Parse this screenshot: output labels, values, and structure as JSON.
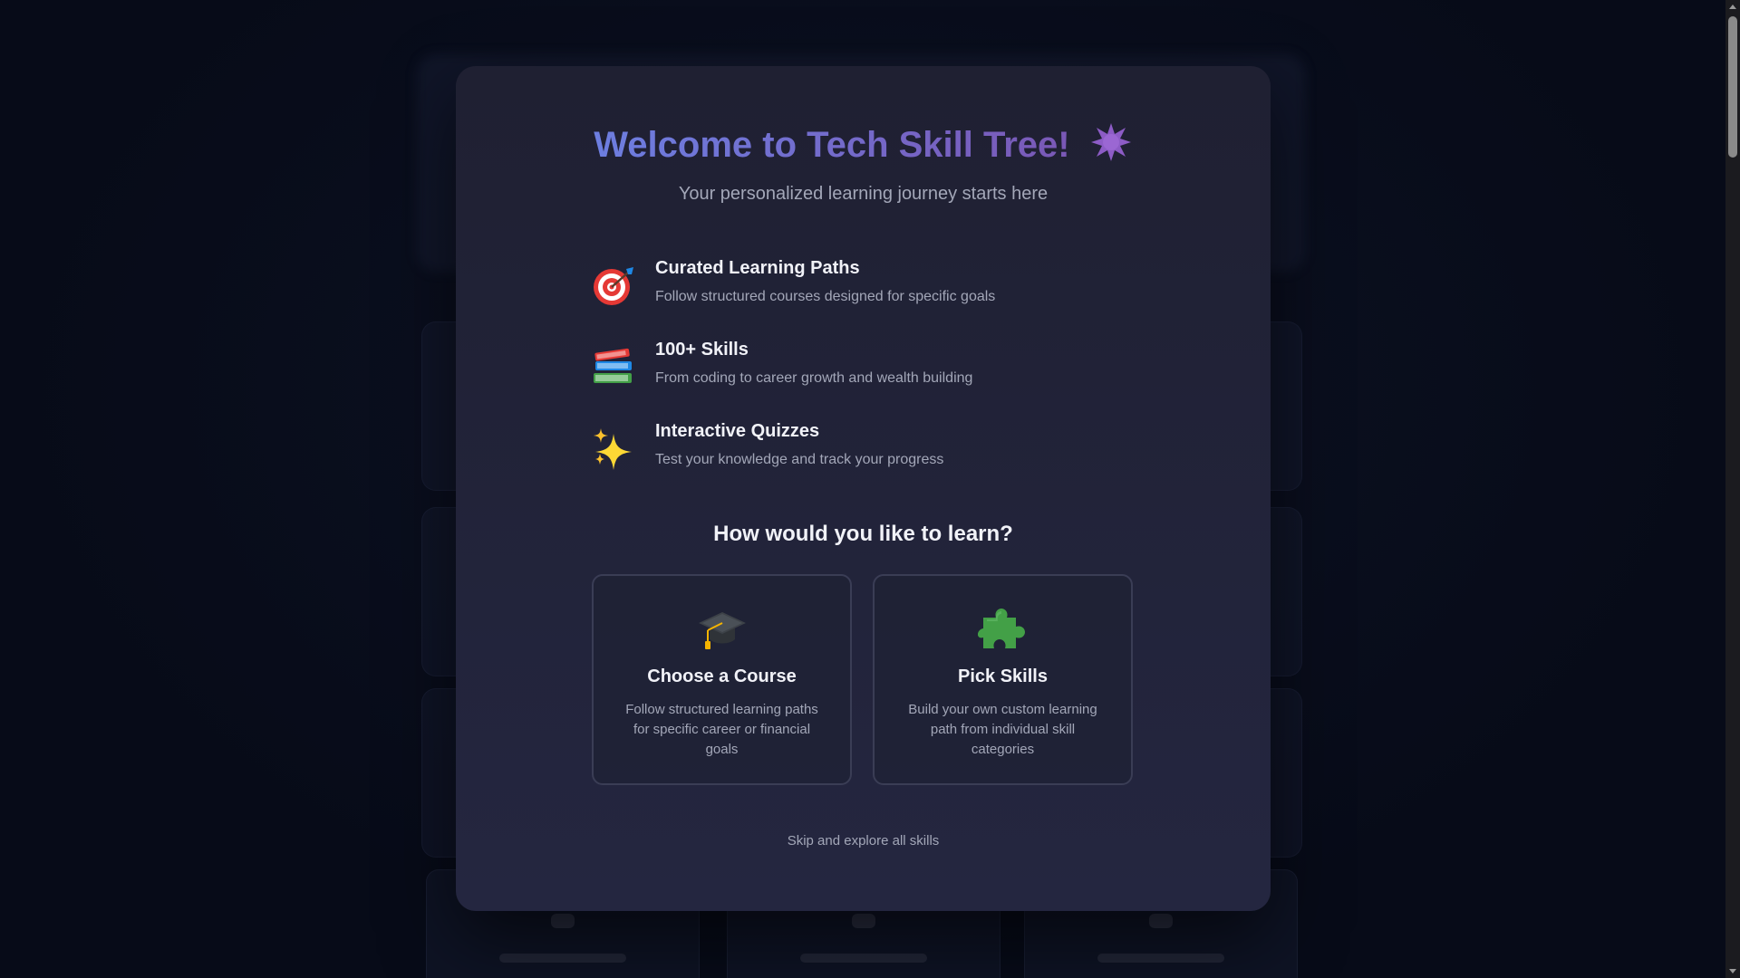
{
  "modal": {
    "title": "Welcome to Tech Skill Tree!",
    "title_icon": "purple-star-icon",
    "subtitle": "Your personalized learning journey starts here",
    "features": [
      {
        "icon": "target-icon",
        "title": "Curated Learning Paths",
        "description": "Follow structured courses designed for specific goals"
      },
      {
        "icon": "books-icon",
        "title": "100+ Skills",
        "description": "From coding to career growth and wealth building"
      },
      {
        "icon": "sparkles-icon",
        "title": "Interactive Quizzes",
        "description": "Test your knowledge and track your progress"
      }
    ],
    "question": "How would you like to learn?",
    "options": [
      {
        "icon": "graduation-cap-icon",
        "title": "Choose a Course",
        "description": "Follow structured learning paths for specific career or financial goals"
      },
      {
        "icon": "puzzle-piece-icon",
        "title": "Pick Skills",
        "description": "Build your own custom learning path from individual skill categories"
      }
    ],
    "skip_label": "Skip and explore all skills"
  },
  "colors": {
    "accent_start": "#6d7ee0",
    "accent_end": "#7a58b6",
    "modal_bg": "#1f2032",
    "page_bg": "#070b18"
  }
}
